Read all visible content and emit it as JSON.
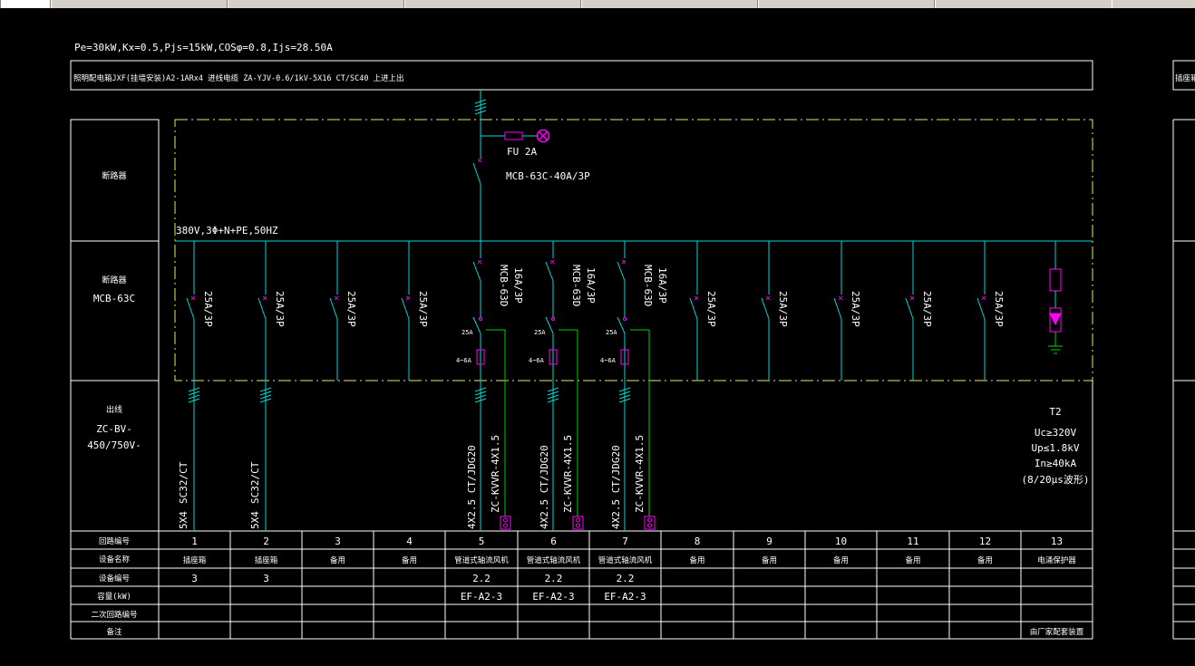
{
  "tabs": [
    {
      "label": "",
      "active": true
    },
    {
      "label": "",
      "active": false
    },
    {
      "label": "",
      "active": false
    },
    {
      "label": "",
      "active": false
    },
    {
      "label": "",
      "active": false
    },
    {
      "label": "",
      "active": false
    },
    {
      "label": "",
      "active": false
    }
  ],
  "colors": {
    "wire": "#00d8d8",
    "device": "#ff00ff",
    "control": "#00d000",
    "border": "#ffffff",
    "dashed": "#e8e860",
    "text": "#ffffff"
  },
  "header": {
    "calc": "Pe=30kW,Kx=0.5,Pjs=15kW,COSφ=0.8,Ijs=28.50A",
    "title": "照明配电箱JXF(挂墙安装)A2-1ARx4  进线电缆 ZA-YJV-0.6/1kV-5X16  CT/SC40  上进上出"
  },
  "sections": {
    "main_breaker_label": "断路器",
    "branch_breaker_label": "断路器",
    "branch_breaker_model": "MCB-63C",
    "outgoing_label": "出线",
    "outgoing_cable_1": "ZC-BV-",
    "outgoing_cable_2": "450/750V-"
  },
  "main": {
    "fuse": "FU 2A",
    "breaker": "MCB-63C-40A/3P",
    "bus": "380V,3Φ+N+PE,50HZ"
  },
  "spd": {
    "type": "T2",
    "uc": "Uc≥320V",
    "up": "Up≤1.8kV",
    "in": "In≥40kA",
    "wave": "(8/20μs波形)"
  },
  "circuits": [
    {
      "breaker": "25A/3P",
      "kind": "std",
      "cable": "SC32/CT",
      "cable2": "5X4",
      "num": "1",
      "name": "插座箱",
      "dev": "3",
      "cap": "",
      "sec": "",
      "remark": ""
    },
    {
      "breaker": "25A/3P",
      "kind": "std",
      "cable": "SC32/CT",
      "cable2": "5X4",
      "num": "2",
      "name": "插座箱",
      "dev": "3",
      "cap": "",
      "sec": "",
      "remark": ""
    },
    {
      "breaker": "25A/3P",
      "kind": "spare",
      "num": "3",
      "name": "备用",
      "dev": "",
      "cap": "",
      "sec": "",
      "remark": ""
    },
    {
      "breaker": "25A/3P",
      "kind": "spare",
      "num": "4",
      "name": "备用",
      "dev": "",
      "cap": "",
      "sec": "",
      "remark": ""
    },
    {
      "breaker": "MCB-63D",
      "breaker2": "16A/3P",
      "kind": "motor",
      "contactor": "25A",
      "relay": "4~6A",
      "cable": "4X2.5  CT/JDG20",
      "ctrl": "ZC-KVVR-4X1.5",
      "num": "5",
      "name": "管道式轴流风机",
      "dev": "2.2",
      "cap": "EF-A2-3",
      "sec": "",
      "remark": ""
    },
    {
      "breaker": "MCB-63D",
      "breaker2": "16A/3P",
      "kind": "motor",
      "contactor": "25A",
      "relay": "4~6A",
      "cable": "4X2.5  CT/JDG20",
      "ctrl": "ZC-KVVR-4X1.5",
      "num": "6",
      "name": "管道式轴流风机",
      "dev": "2.2",
      "cap": "EF-A2-3",
      "sec": "",
      "remark": ""
    },
    {
      "breaker": "MCB-63D",
      "breaker2": "16A/3P",
      "kind": "motor",
      "contactor": "25A",
      "relay": "4~6A",
      "cable": "4X2.5  CT/JDG20",
      "ctrl": "ZC-KVVR-4X1.5",
      "num": "7",
      "name": "管道式轴流风机",
      "dev": "2.2",
      "cap": "EF-A2-3",
      "sec": "",
      "remark": ""
    },
    {
      "breaker": "25A/3P",
      "kind": "spare",
      "num": "8",
      "name": "备用",
      "dev": "",
      "cap": "",
      "sec": "",
      "remark": ""
    },
    {
      "breaker": "25A/3P",
      "kind": "spare",
      "num": "9",
      "name": "备用",
      "dev": "",
      "cap": "",
      "sec": "",
      "remark": ""
    },
    {
      "breaker": "25A/3P",
      "kind": "spare",
      "num": "10",
      "name": "备用",
      "dev": "",
      "cap": "",
      "sec": "",
      "remark": ""
    },
    {
      "breaker": "25A/3P",
      "kind": "spare",
      "num": "11",
      "name": "备用",
      "dev": "",
      "cap": "",
      "sec": "",
      "remark": ""
    },
    {
      "breaker": "25A/3P",
      "kind": "spare",
      "num": "12",
      "name": "备用",
      "dev": "",
      "cap": "",
      "sec": "",
      "remark": ""
    },
    {
      "kind": "spd",
      "num": "13",
      "name": "电涌保护器",
      "dev": "",
      "cap": "",
      "sec": "",
      "remark": "由厂家配套装置"
    }
  ],
  "table_rows": [
    "回路编号",
    "设备名称",
    "设备编号",
    "容量(kW)",
    "二次回路编号",
    "备注"
  ],
  "right_fragment": "插座箱"
}
